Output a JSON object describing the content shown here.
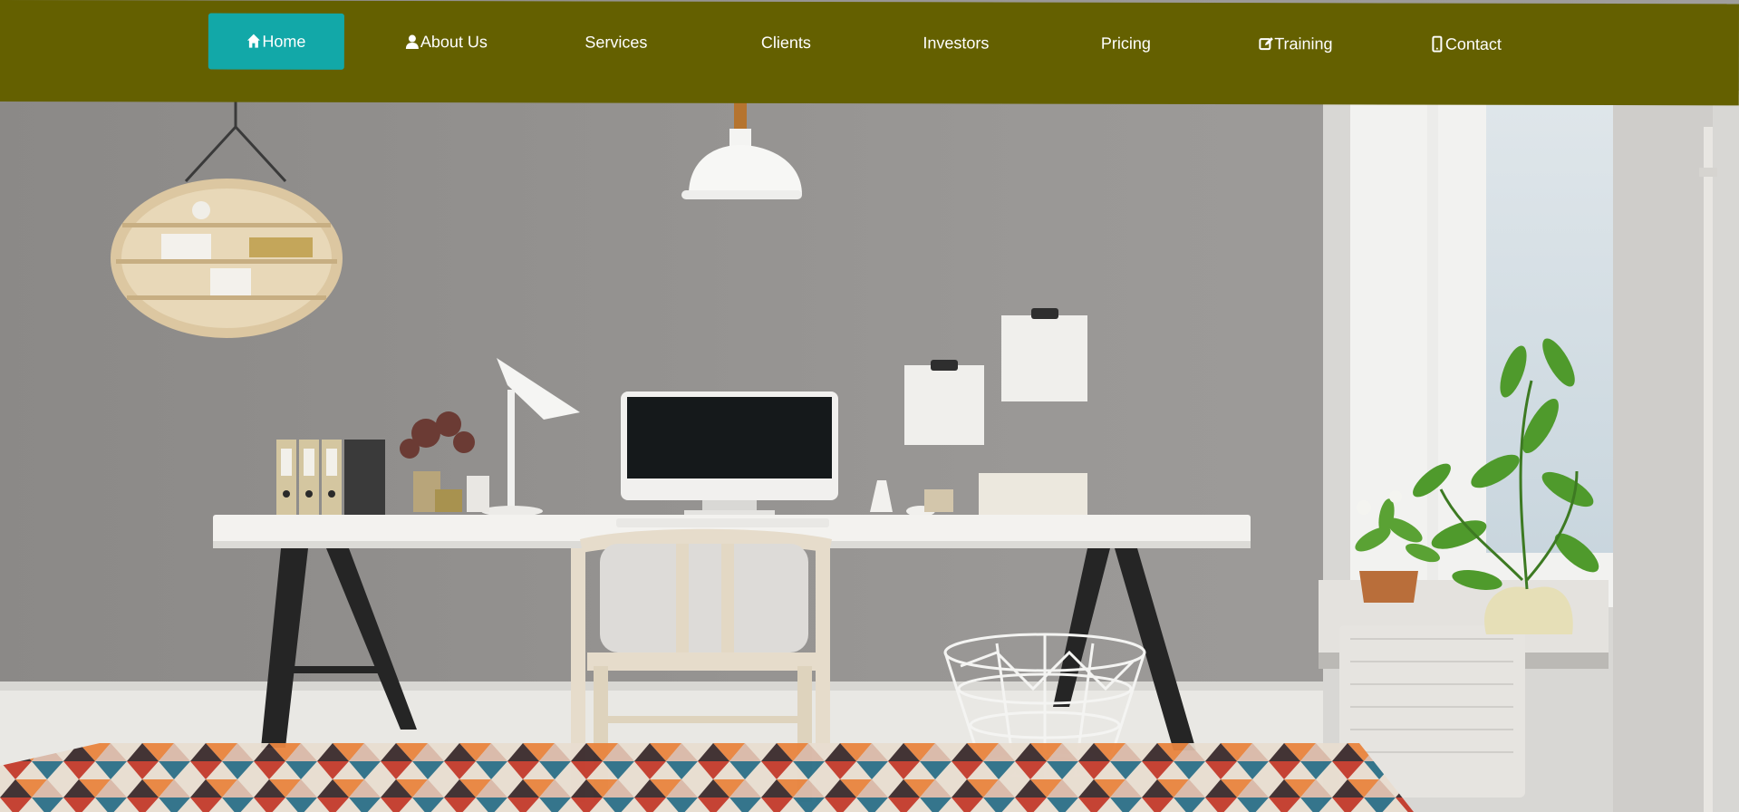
{
  "nav": {
    "items": [
      {
        "label": "Home",
        "icon": "home-icon",
        "active": true
      },
      {
        "label": "About Us",
        "icon": "user-icon",
        "active": false
      },
      {
        "label": "Services",
        "icon": "",
        "active": false
      },
      {
        "label": "Clients",
        "icon": "",
        "active": false
      },
      {
        "label": "Investors",
        "icon": "",
        "active": false
      },
      {
        "label": "Pricing",
        "icon": "",
        "active": false
      },
      {
        "label": "Training",
        "icon": "edit-icon",
        "active": false
      },
      {
        "label": "Contact",
        "icon": "mobile-phone-icon",
        "active": false
      }
    ]
  },
  "colors": {
    "navbar_bg": "#646000",
    "active_bg": "#12a8a8",
    "nav_text": "#ffffff"
  },
  "hero": {
    "image": "office-workspace-photo"
  }
}
